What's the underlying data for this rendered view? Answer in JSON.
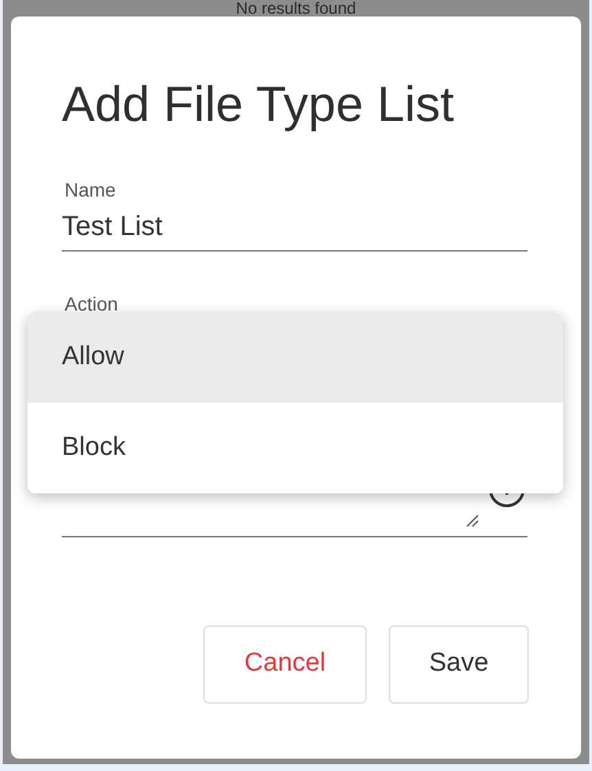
{
  "background": {
    "text": "No results found"
  },
  "dialog": {
    "title": "Add File Type List",
    "fields": [
      {
        "kind": "text",
        "label": "Name",
        "value": "Test List"
      },
      {
        "kind": "select",
        "label": "Action"
      },
      {
        "kind": "textarea"
      }
    ],
    "menu": [
      {
        "label": "Allow",
        "selected": true
      },
      {
        "label": "Block",
        "selected": false
      }
    ],
    "buttons": [
      {
        "label": "Cancel",
        "kind": "danger"
      },
      {
        "label": "Save",
        "kind": "default"
      }
    ]
  }
}
